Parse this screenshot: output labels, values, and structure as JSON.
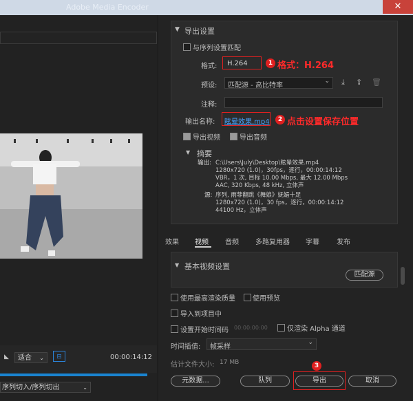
{
  "titlebar": {
    "title": "Adobe Media Encoder",
    "close": "✕"
  },
  "export_settings": {
    "section_title": "导出设置",
    "match_sequence": "与序列设置匹配",
    "format_label": "格式:",
    "format_value": "H.264",
    "preset_label": "预设:",
    "preset_value": "匹配源 - 高比特率",
    "comment_label": "注释:",
    "output_name_label": "输出名称:",
    "output_name_value": "眩晕效果.mp4",
    "export_video": "导出视频",
    "export_audio": "导出音频"
  },
  "summary": {
    "title": "摘要",
    "output_label": "输出:",
    "output_lines": [
      "C:\\Users\\July\\Desktop\\眩晕效果.mp4",
      "1280x720 (1.0)，30fps，逐行，00:00:14:12",
      "VBR，1 次, 目标 10.00 Mbps, 最大 12.00 Mbps",
      "AAC, 320 Kbps, 48  kHz, 立体声"
    ],
    "source_label": "源:",
    "source_lines": [
      "序列, 雨菲翻跳《舞娘》妩媚十足",
      "1280x720 (1.0)，30 fps，逐行，00:00:14:12",
      "44100 Hz，立体声"
    ]
  },
  "tabs": [
    "效果",
    "视频",
    "音频",
    "多路复用器",
    "字幕",
    "发布"
  ],
  "basic_video": {
    "title": "基本视频设置",
    "match_source": "匹配源"
  },
  "options": {
    "max_render": "使用最高渲染质量",
    "use_preview": "使用预览",
    "import_project": "导入到项目中",
    "set_timecode": "设置开始时间码",
    "timecode_value": "00:00:00:00",
    "render_alpha": "仅渲染 Alpha 通道",
    "interp_label": "时间插值:",
    "interp_value": "帧采样",
    "filesize_label": "估计文件大小:",
    "filesize_value": "17 MB"
  },
  "buttons": {
    "metadata": "元数据...",
    "queue": "队列",
    "export": "导出",
    "cancel": "取消"
  },
  "annotations": {
    "badge1": "1",
    "anno1": "格式：H.264",
    "badge2": "2",
    "anno2": "点击设置保存位置",
    "badge3": "3"
  },
  "source_monitor": {
    "fit": "适合",
    "timecode": "00:00:14:12",
    "source_range": "序列切入/序列切出"
  },
  "colors": {
    "accent": "#1a84d0",
    "annotation": "#e02020"
  }
}
